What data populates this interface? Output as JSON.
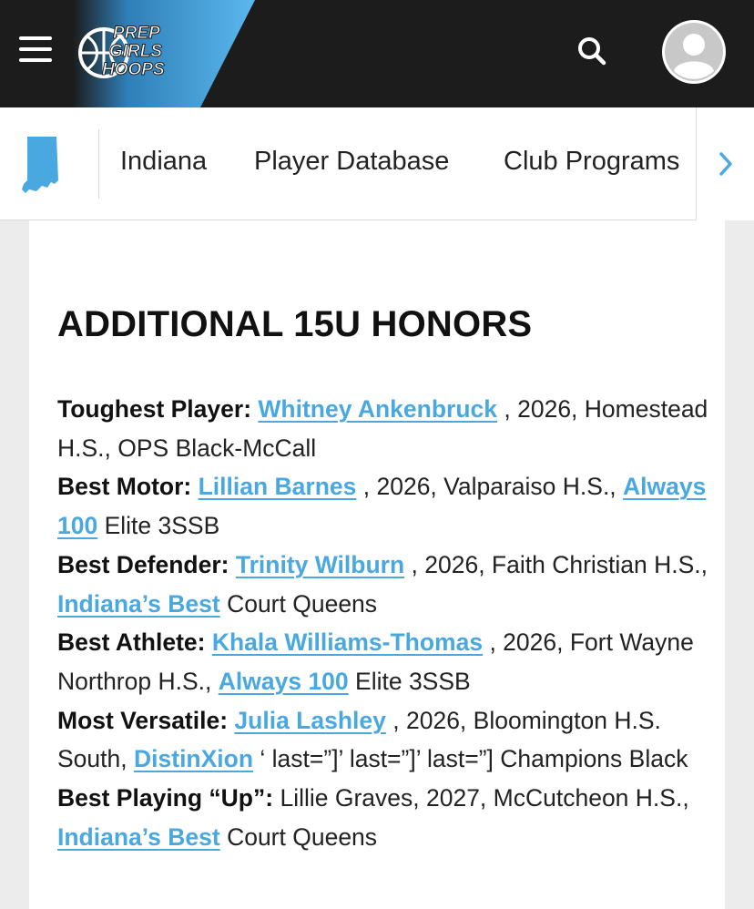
{
  "colors": {
    "header_bg": "#1c1c1c",
    "accent_blue": "#4aa8e0",
    "stripe_blue": "#5bb8ee"
  },
  "header": {
    "logo_lines": [
      "PREP",
      "GIRLS",
      "HOOPS"
    ],
    "icons": {
      "menu": "hamburger-menu-icon",
      "search": "search-icon",
      "profile": "user-avatar-icon"
    }
  },
  "subnav": {
    "state_icon": "indiana-state-icon",
    "items": [
      "Indiana",
      "Player Database",
      "Club Programs"
    ],
    "more_icon": "chevron-right-icon"
  },
  "article": {
    "title": "ADDITIONAL 15U HONORS",
    "honors": [
      {
        "award": "Toughest Player:",
        "player": "Whitney Ankenbruck",
        "details": ", 2026, Homestead H.S., OPS Black-McCall"
      },
      {
        "award": "Best Motor:",
        "player": "Lillian Barnes",
        "details": ", 2026, Valparaiso H.S.,",
        "club_link": "Always 100",
        "club_rest": "Elite 3SSB"
      },
      {
        "award": "Best Defender:",
        "player": "Trinity Wilburn",
        "details": ", 2026, Faith Christian H.S.,",
        "club_link": "Indiana’s Best",
        "club_rest": "Court Queens"
      },
      {
        "award": "Best Athlete:",
        "player": "Khala Williams-Thomas",
        "details": ", 2026, Fort Wayne Northrop H.S.,",
        "club_link": "Always 100",
        "club_rest": "Elite 3SSB"
      },
      {
        "award": "Most Versatile:",
        "player": "Julia Lashley",
        "details": ", 2026, Bloomington H.S. South,",
        "club_link": "DistinXion",
        "club_rest": "‘ last=”]’ last=”]’ last=”] Champions Black"
      },
      {
        "award": "Best Playing “Up”:",
        "player_text": "Lillie Graves, 2027, McCutcheon H.S.,",
        "club_link": "Indiana’s Best",
        "club_rest": "Court Queens"
      }
    ]
  }
}
